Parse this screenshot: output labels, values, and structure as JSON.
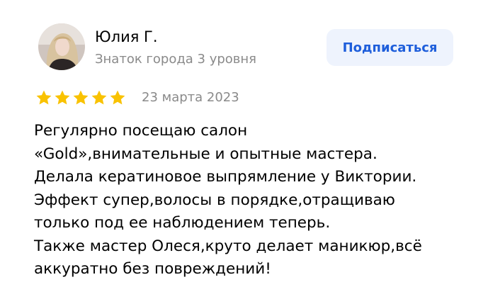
{
  "review": {
    "author_name": "Юлия Г.",
    "author_level": "Знаток города 3 уровня",
    "subscribe_label": "Подписаться",
    "rating": 5,
    "rating_max": 5,
    "date": "23 марта 2023",
    "text_lines": [
      "Регулярно посещаю салон",
      "«Gold»,внимательные и опытные мастера.",
      "Делала кератиновое выпрямление у Виктории.",
      "Эффект супер,волосы в порядке,отращиваю",
      "только под ее наблюдением теперь.",
      "Также мастер Олеся,круто делает маникюр,всё",
      "аккуратно без повреждений!"
    ]
  },
  "colors": {
    "star": "#f9c200",
    "accent": "#1e5edb",
    "button_bg": "#eef3fd",
    "muted_text": "#8a8a8a"
  },
  "icons": {
    "avatar": "user-photo-avatar",
    "rating_star": "star-icon"
  }
}
